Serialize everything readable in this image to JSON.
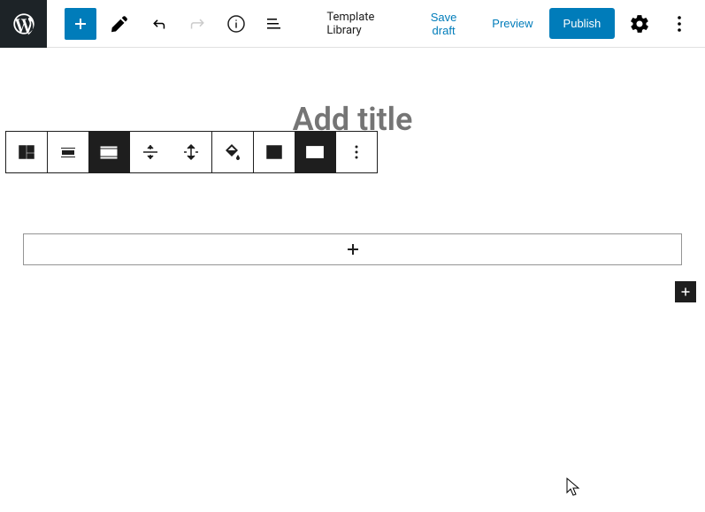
{
  "topbar": {
    "template_library": "Template Library",
    "save_draft": "Save draft",
    "preview": "Preview",
    "publish": "Publish"
  },
  "editor": {
    "title_placeholder": "Add title"
  },
  "icons": {
    "wordpress": "wordpress-logo",
    "add": "plus",
    "edit": "pencil",
    "undo": "undo",
    "redo": "redo",
    "info": "info",
    "outline": "list-view",
    "settings": "gear",
    "more": "more-vertical"
  }
}
